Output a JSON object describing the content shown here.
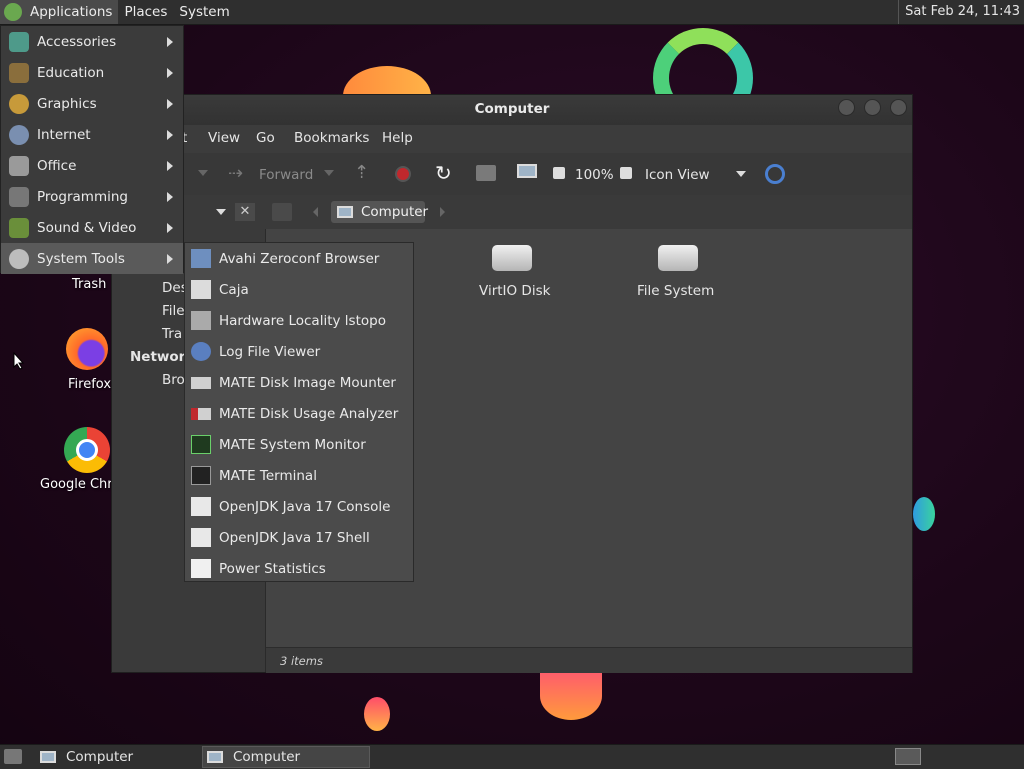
{
  "top_panel": {
    "menus": [
      "Applications",
      "Places",
      "System"
    ],
    "clock": "Sat Feb 24, 11:43"
  },
  "desktop_icons": {
    "trash": "Trash",
    "firefox": "Firefox",
    "chrome": "Google Chr"
  },
  "window": {
    "title": "Computer",
    "menus": [
      "t",
      "View",
      "Go",
      "Bookmarks",
      "Help"
    ],
    "toolbar": {
      "forward": "Forward",
      "zoom": "100%",
      "view_mode": "Icon View"
    },
    "location": {
      "crumb": "Computer"
    },
    "sidebar": {
      "items": [
        "Des",
        "File",
        "Tra"
      ],
      "network_heading": "Network",
      "network_item": "Bro"
    },
    "content_items": [
      "VirtIO Disk",
      "File System"
    ],
    "status": "3 items"
  },
  "app_menu": {
    "items": [
      "Accessories",
      "Education",
      "Graphics",
      "Internet",
      "Office",
      "Programming",
      "Sound & Video",
      "System Tools"
    ],
    "active": "System Tools"
  },
  "system_tools": {
    "items": [
      "Avahi Zeroconf Browser",
      "Caja",
      "Hardware Locality lstopo",
      "Log File Viewer",
      "MATE Disk Image Mounter",
      "MATE Disk Usage Analyzer",
      "MATE System Monitor",
      "MATE Terminal",
      "OpenJDK Java 17 Console",
      "OpenJDK Java 17 Shell",
      "Power Statistics"
    ]
  },
  "taskbar": {
    "buttons": [
      "Computer",
      "Computer"
    ]
  },
  "colors": {
    "panel": "#2f2f2f",
    "menu": "#3b3b3b",
    "submenu": "#4b4b4b",
    "highlight": "#5a5a5a",
    "wallpaper": "#1c0618"
  }
}
